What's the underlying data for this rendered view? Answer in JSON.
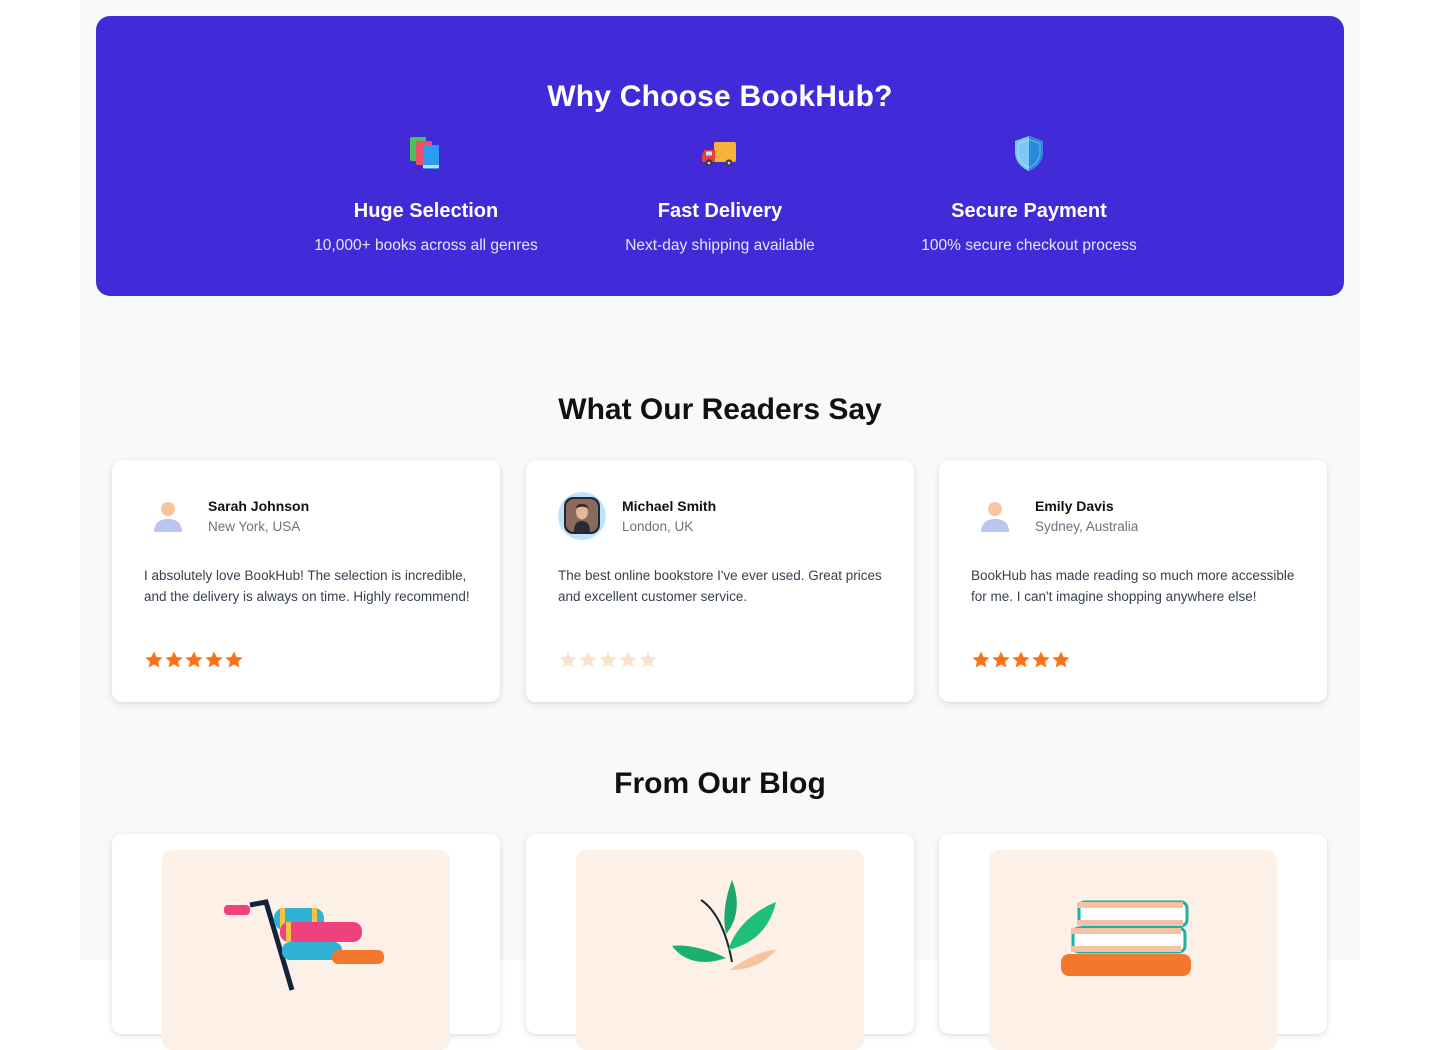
{
  "why": {
    "title": "Why Choose BookHub?",
    "features": [
      {
        "icon": "books-icon",
        "title": "Huge Selection",
        "desc": "10,000+ books across all genres"
      },
      {
        "icon": "delivery-truck-icon",
        "title": "Fast Delivery",
        "desc": "Next-day shipping available"
      },
      {
        "icon": "shield-icon",
        "title": "Secure Payment",
        "desc": "100% secure checkout process"
      }
    ]
  },
  "testimonials": {
    "title": "What Our Readers Say",
    "items": [
      {
        "name": "Sarah Johnson",
        "location": "New York, USA",
        "text": "I absolutely love BookHub! The selection is incredible, and the delivery is always on time. Highly recommend!",
        "rating": 5
      },
      {
        "name": "Michael Smith",
        "location": "London, UK",
        "text": "The best online bookstore I've ever used. Great prices and excellent customer service.",
        "rating": 0
      },
      {
        "name": "Emily Davis",
        "location": "Sydney, Australia",
        "text": "BookHub has made reading so much more accessible for me. I can't imagine shopping anywhere else!",
        "rating": 5
      }
    ]
  },
  "blog": {
    "title": "From Our Blog"
  },
  "colors": {
    "banner": "#432ad8",
    "star": "#f97316",
    "star_empty": "#fde3cc"
  }
}
